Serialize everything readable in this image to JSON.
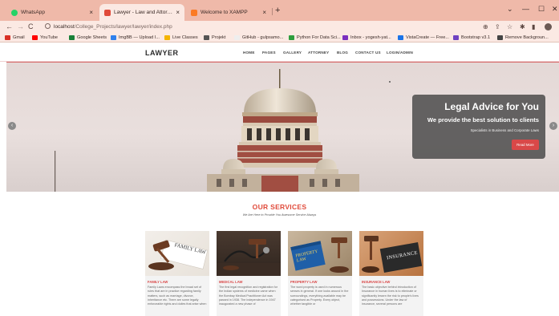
{
  "browser": {
    "tabs": [
      {
        "label": "WhatsApp",
        "close": "×",
        "favicon_color": "#25d366",
        "active": false
      },
      {
        "label": "Lawyer - Law and Attorney Web...",
        "close": "×",
        "favicon_color": "#e04a3a",
        "active": true
      },
      {
        "label": "Welcome to XAMPP",
        "close": "×",
        "favicon_color": "#fb7a24",
        "active": false
      }
    ],
    "new_tab": "+",
    "window_controls": {
      "chevron": "⌄",
      "minimize": "—",
      "maximize": "☐",
      "close": "✕"
    },
    "nav": {
      "back": "←",
      "forward": "→",
      "reload": "C"
    },
    "url_host": "localhost",
    "url_path": "/College_Projects/lawyer/lawyer/index.php",
    "bookmarks": [
      {
        "label": "Gmail",
        "color": "#d93025"
      },
      {
        "label": "YouTube",
        "color": "#ff0000"
      },
      {
        "label": "Google Sheets",
        "color": "#188038"
      },
      {
        "label": "ImgBB — Upload I...",
        "color": "#2f80ed"
      },
      {
        "label": "Live Classes",
        "color": "#f4b400"
      },
      {
        "label": "Projekt",
        "color": "#555555"
      },
      {
        "label": "GitHub - gulpsamo...",
        "color": "#eeeeee"
      },
      {
        "label": "Python For Data Sci...",
        "color": "#2e9e3e"
      },
      {
        "label": "Inbox - yogesh-yat...",
        "color": "#7b2fbf"
      },
      {
        "label": "VistaCreate — Free...",
        "color": "#1a73e8"
      },
      {
        "label": "Bootstrap v3.1",
        "color": "#6f42c1"
      },
      {
        "label": "Remove Backgroun...",
        "color": "#444444"
      }
    ]
  },
  "site": {
    "brand": "LAWYER",
    "menu": [
      "HOME",
      "PAGES",
      "GALLERY",
      "ATTORNEY",
      "BLOG",
      "CONTACT US",
      "LOGIN/ADMIN"
    ],
    "hero": {
      "title": "Legal Advice for You",
      "subtitle": "We provide the best solution to clients",
      "tagline": "Specialists in Business and Corporate Laws",
      "button": "Read More",
      "prev": "‹",
      "next": "›"
    },
    "services": {
      "title": "OUR SERVICES",
      "tagline": "We Are Here to Provide You Awesome Service Always",
      "cards": [
        {
          "title": "FAMILY LAW",
          "image_text": "FAMILY LAW",
          "text": "Family Laws encompass the broad set of rules that are in practice regarding family matters, such as marriage, divorce, inheritance etc. There are some legally enforceable rights and duties that arise when"
        },
        {
          "title": "MEDICAL LAW",
          "image_text": "",
          "text": "The first legal recognition and registration for the Indian systems of medicine came when the Bombay Medical Practitioner Act was passed in 1938. The independence in 1947 inaugurated a new phase of"
        },
        {
          "title": "PROPERTY LAW",
          "image_text": "PROPERTY LAW",
          "text": "The word property is used in numerous senses in general. If one looks around in the surroundings, everything available may be categorised as Property. Every object, whether tangible or"
        },
        {
          "title": "INSURANCE LAW",
          "image_text": "INSURANCE",
          "text": "The basic objective behind introduction of Insurance in human lives is to eliminate or significantly lessen the risk to people's lives and possessions. Under the law of insurance, several persons are"
        }
      ]
    }
  },
  "colors": {
    "tabbar": "#efb9a9",
    "chrome": "#fbe9e3",
    "accent": "#e04a3a",
    "button": "#d94848"
  }
}
